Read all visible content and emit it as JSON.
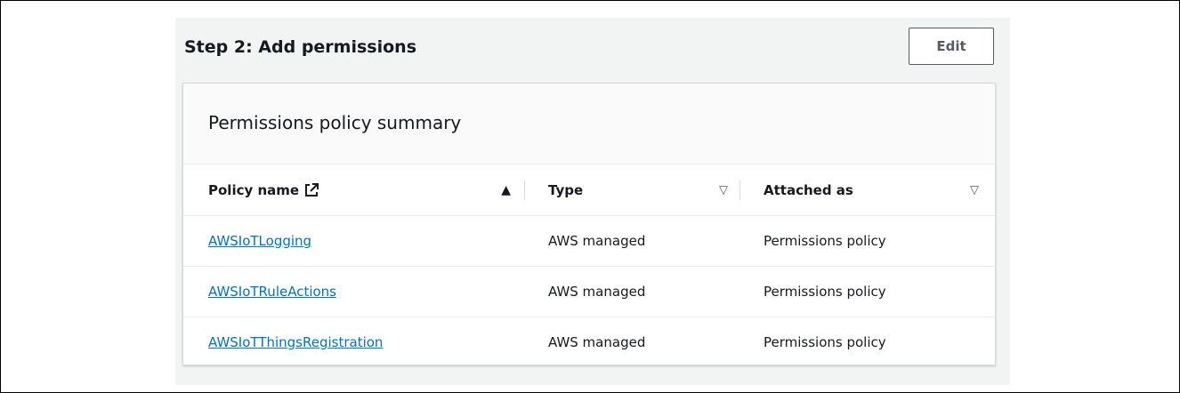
{
  "step": {
    "title": "Step 2: Add permissions",
    "edit_label": "Edit"
  },
  "summary": {
    "title": "Permissions policy summary",
    "columns": [
      {
        "label": "Policy name",
        "sort": "ascending",
        "icon": "external-link-icon"
      },
      {
        "label": "Type",
        "sort": "none"
      },
      {
        "label": "Attached as",
        "sort": "none"
      }
    ],
    "rows": [
      {
        "name": "AWSIoTLogging",
        "type": "AWS managed",
        "attached": "Permissions policy"
      },
      {
        "name": "AWSIoTRuleActions",
        "type": "AWS managed",
        "attached": "Permissions policy"
      },
      {
        "name": "AWSIoTThingsRegistration",
        "type": "AWS managed",
        "attached": "Permissions policy"
      }
    ]
  },
  "colors": {
    "link": "#0073bb",
    "text": "#16191f",
    "panel_bg": "#f2f3f3",
    "border": "#d5dbdb"
  }
}
